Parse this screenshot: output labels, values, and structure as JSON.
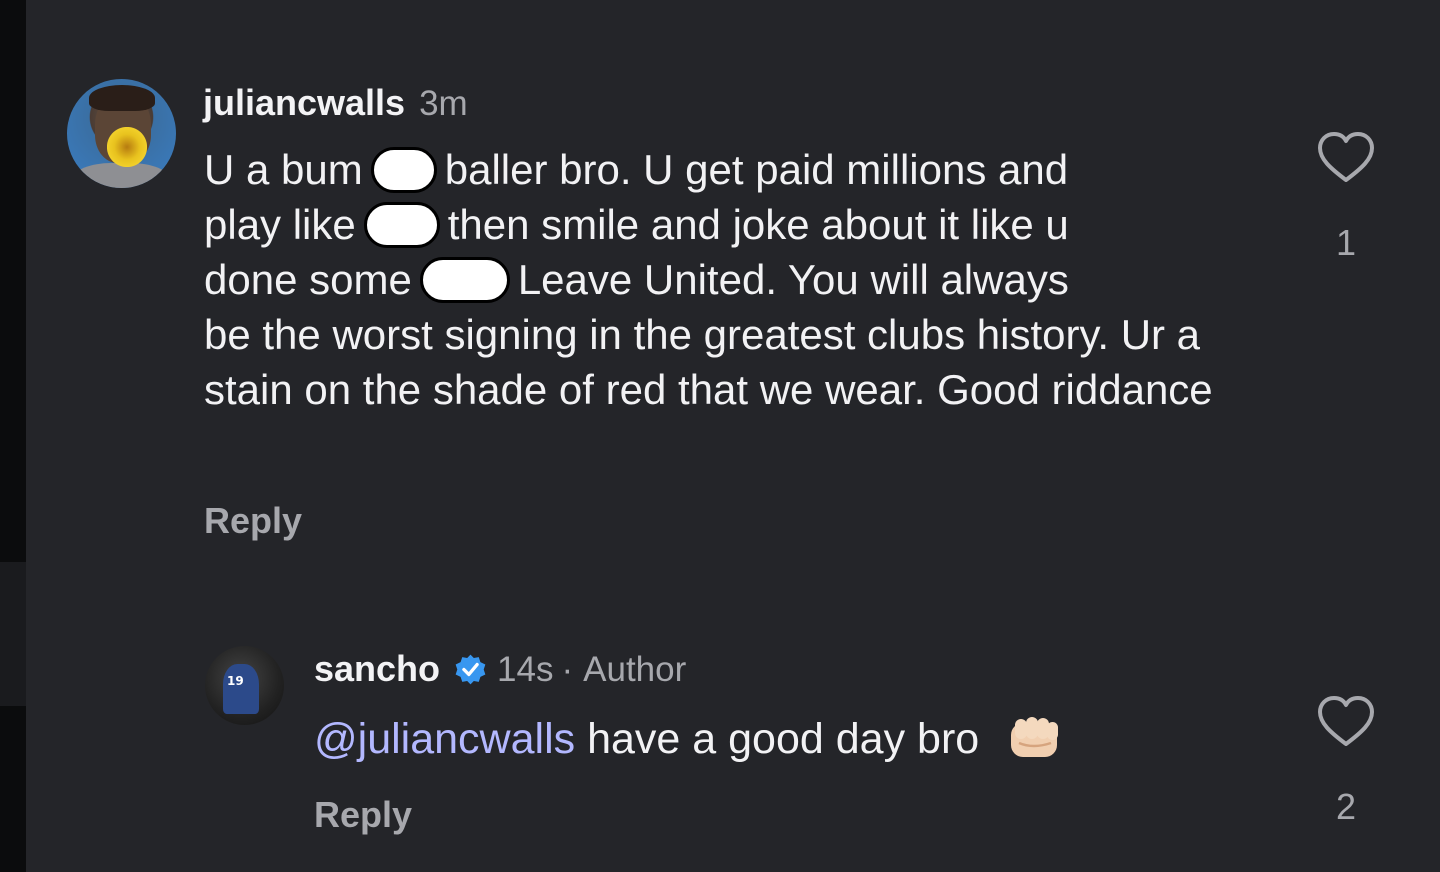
{
  "comment": {
    "username": "juliancwalls",
    "time": "3m",
    "text_line1_a": "U a bum",
    "text_line1_b": "baller bro. U get paid millions and",
    "text_line2_a": "play like",
    "text_line2_b": "then smile and joke about it like u",
    "text_line3_a": "done some",
    "text_line3_b": "Leave United. You will always",
    "text_rest": "be the worst signing in the greatest clubs history. Ur a stain on the shade of red that we wear. Good riddance",
    "reply_label": "Reply",
    "like_count": "1"
  },
  "reply": {
    "username": "sancho",
    "verified": true,
    "time": "14s",
    "separator": "·",
    "author_label": "Author",
    "mention": "@juliancwalls",
    "text": "have a good day bro",
    "emoji_icon": "fist-bump-icon",
    "reply_label": "Reply",
    "like_count": "2"
  },
  "colors": {
    "background": "#242529",
    "text": "#f2f2f4",
    "secondary": "#a7a8ad",
    "mention": "#b3b8ff",
    "verified": "#3897f0"
  }
}
